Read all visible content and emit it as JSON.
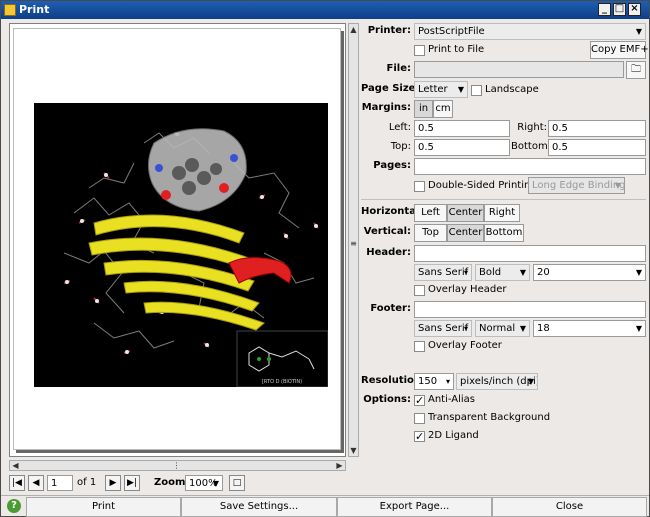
{
  "window": {
    "title": "Print"
  },
  "preview": {
    "inset_caption": "[RTO D (BIOTIN)"
  },
  "navigation": {
    "page_value": "1",
    "of_label": "of 1",
    "zoom_label": "Zoom:",
    "zoom_value": "100%"
  },
  "printer": {
    "label": "Printer:",
    "value": "PostScriptFile",
    "print_to_file_label": "Print to File",
    "copy_emf_label": "Copy EMF+",
    "file_label": "File:",
    "file_value": ""
  },
  "page": {
    "page_size_label": "Page Size:",
    "page_size_value": "Letter",
    "landscape_label": "Landscape",
    "margins_label": "Margins:",
    "unit_in": "in",
    "unit_cm": "cm",
    "left_label": "Left:",
    "left_value": "0.5",
    "right_label": "Right:",
    "right_value": "0.5",
    "top_label": "Top:",
    "top_value": "0.5",
    "bottom_label": "Bottom:",
    "bottom_value": "0.5",
    "pages_label": "Pages:",
    "pages_value": "",
    "double_sided_label": "Double-Sided Printing",
    "binding_value": "Long Edge Binding"
  },
  "alignment": {
    "horizontal_label": "Horizontal:",
    "h_left": "Left",
    "h_center": "Center",
    "h_right": "Right",
    "vertical_label": "Vertical:",
    "v_top": "Top",
    "v_center": "Center",
    "v_bottom": "Bottom"
  },
  "header": {
    "label": "Header:",
    "text": "",
    "font": "Sans Serif",
    "style": "Bold",
    "size": "20",
    "overlay_label": "Overlay Header"
  },
  "footer": {
    "label": "Footer:",
    "text": "",
    "font": "Sans Serif",
    "style": "Normal",
    "size": "18",
    "overlay_label": "Overlay Footer"
  },
  "output": {
    "resolution_label": "Resolution:",
    "resolution_value": "150",
    "resolution_unit": "pixels/inch (dpi)",
    "options_label": "Options:",
    "anti_alias_label": "Anti-Alias",
    "anti_alias_checked": true,
    "transparent_bg_label": "Transparent Background",
    "transparent_bg_checked": false,
    "ligand_2d_label": "2D Ligand",
    "ligand_2d_checked": true
  },
  "actions": {
    "print": "Print",
    "save_settings": "Save Settings...",
    "export_page": "Export Page...",
    "close": "Close"
  },
  "colors": {
    "titlebar": "#1f5fb3",
    "ribbon_yellow": "#e8e020",
    "ribbon_red": "#e02020",
    "surface": "#a8a8a8",
    "help_green": "#4b9b33"
  }
}
